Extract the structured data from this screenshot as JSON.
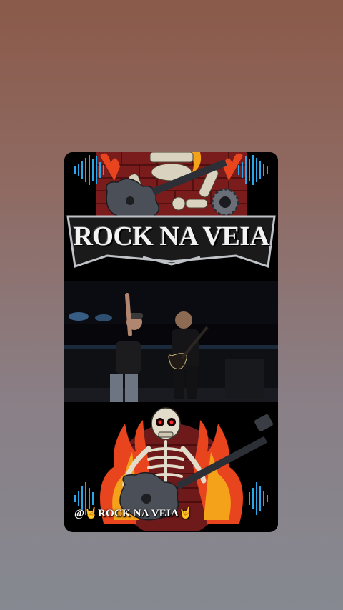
{
  "story": {
    "logo_text": "ROCK NA VEIA",
    "mention_at": "@",
    "mention_name": "ROCK NA VEIA",
    "emoji_left": "🤘",
    "emoji_right": "🤘"
  },
  "colors": {
    "background_top": "#8a5a4a",
    "background_bottom": "#868991",
    "card_bg": "#000000",
    "equalizer": "#2aa7e8",
    "flame": "#e8451f",
    "wordmark": "#f2f2f2"
  }
}
